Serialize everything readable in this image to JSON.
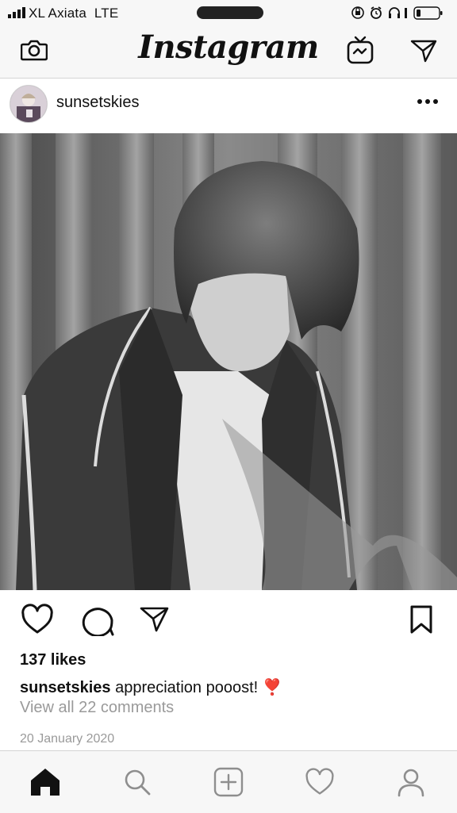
{
  "status_bar": {
    "carrier": "XL Axiata",
    "network": "LTE"
  },
  "header": {
    "app_title": "Instagram",
    "icons": [
      "camera-icon",
      "igtv-icon",
      "direct-message-icon"
    ]
  },
  "post": {
    "username": "sunsetskies",
    "likes": "137 likes",
    "caption_text": "appreciation pooost!",
    "caption_emoji": "❣️",
    "view_comments": "View all 22 comments",
    "date": "20 January 2020",
    "action_icons": [
      "heart-icon",
      "comment-icon",
      "share-icon",
      "bookmark-icon"
    ]
  },
  "tab_bar": {
    "items": [
      "home-icon",
      "search-icon",
      "new-post-icon",
      "activity-icon",
      "profile-icon"
    ],
    "active": "home-icon"
  }
}
